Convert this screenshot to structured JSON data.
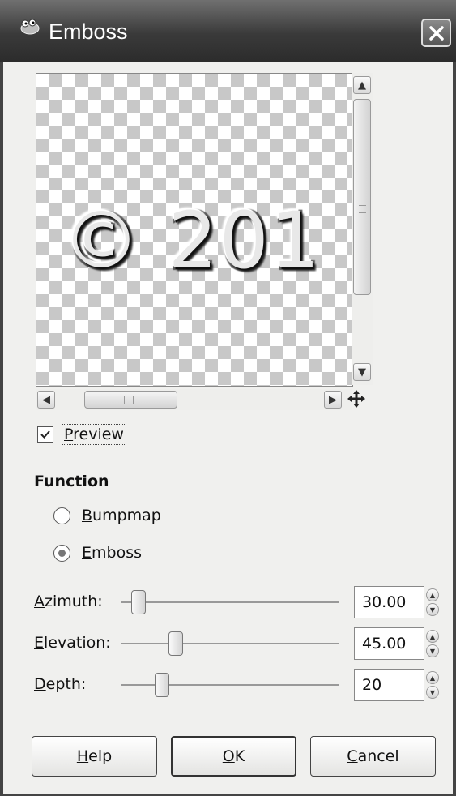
{
  "window": {
    "title": "Emboss"
  },
  "preview": {
    "image_text": "© 201",
    "checkbox_label_mnemonic": "P",
    "checkbox_label_rest": "review",
    "checked": true
  },
  "function": {
    "title": "Function",
    "options": [
      {
        "mnemonic": "B",
        "rest": "umpmap",
        "selected": false
      },
      {
        "mnemonic": "E",
        "rest": "mboss",
        "selected": true
      }
    ]
  },
  "params": [
    {
      "label_mnemonic": "A",
      "label_rest": "zimuth:",
      "value": "30.00",
      "slider_fraction": 0.083
    },
    {
      "label_mnemonic": "E",
      "label_rest": "levation:",
      "value": "45.00",
      "slider_fraction": 0.25
    },
    {
      "label_mnemonic": "D",
      "label_rest": "epth:",
      "value": "20",
      "slider_fraction": 0.19
    }
  ],
  "buttons": {
    "help": {
      "mnemonic": "H",
      "rest": "elp"
    },
    "ok": {
      "mnemonic": "O",
      "rest": "K"
    },
    "cancel": {
      "mnemonic": "C",
      "rest": "ancel"
    }
  },
  "colors": {
    "titlebar": "#3a3a3a",
    "dialog_bg": "#f0f0ee"
  }
}
